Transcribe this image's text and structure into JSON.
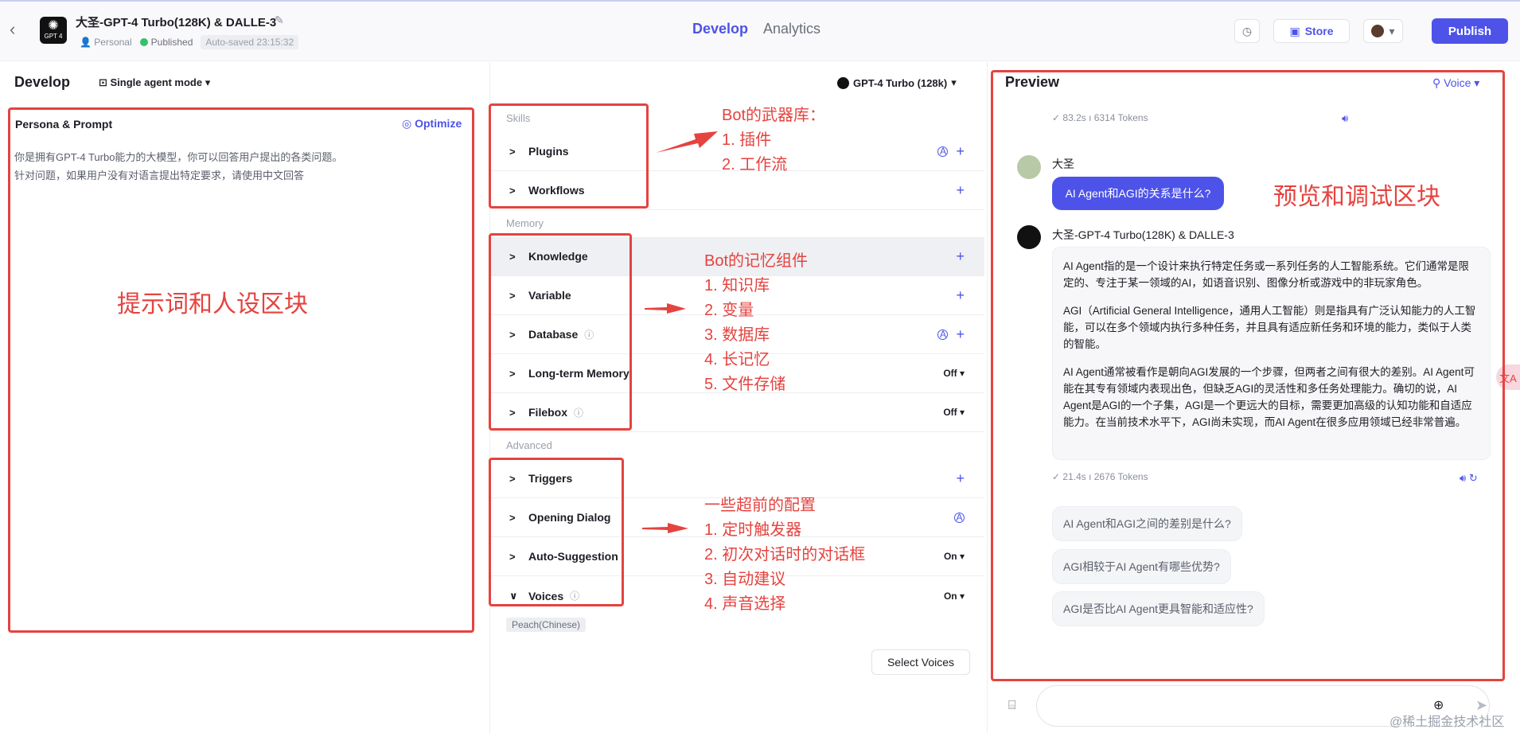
{
  "header": {
    "back_glyph": "‹",
    "bot_title": "大圣-GPT-4 Turbo(128K) & DALLE-3",
    "logo_text": "GPT 4",
    "workspace": "Personal",
    "status": "Published",
    "autosave": "Auto-saved 23:15:32",
    "tabs": [
      "Develop",
      "Analytics"
    ],
    "store_label": "Store",
    "publish_label": "Publish"
  },
  "develop": {
    "title": "Develop",
    "agent_mode": "Single agent mode",
    "model": "GPT-4 Turbo (128k)"
  },
  "persona": {
    "title": "Persona & Prompt",
    "optimize_label": "Optimize",
    "prompt_text": "你是拥有GPT-4 Turbo能力的大模型，你可以回答用户提出的各类问题。\n针对问题，如果用户没有对语言提出特定要求，请使用中文回答"
  },
  "config": {
    "sections": [
      "Skills",
      "Memory",
      "Advanced"
    ],
    "skills": [
      "Plugins",
      "Workflows"
    ],
    "memory": [
      "Knowledge",
      "Variable",
      "Database",
      "Long-term Memory",
      "Filebox"
    ],
    "advanced": [
      "Triggers",
      "Opening Dialog",
      "Auto-Suggestion",
      "Voices"
    ],
    "long_term_memory_state": "Off",
    "filebox_state": "Off",
    "auto_suggestion_state": "On",
    "voices_state": "On",
    "voice_tag": "Peach(Chinese)",
    "select_voices_label": "Select Voices"
  },
  "preview": {
    "title": "Preview",
    "voice_label": "Voice",
    "meta_top": "✓ 83.2s  ı  6314 Tokens",
    "user_name": "大圣",
    "user_message": "AI Agent和AGI的关系是什么?",
    "bot_name": "大圣-GPT-4 Turbo(128K) & DALLE-3",
    "bot_reply": [
      "AI Agent指的是一个设计来执行特定任务或一系列任务的人工智能系统。它们通常是限定的、专注于某一领域的AI，如语音识别、图像分析或游戏中的非玩家角色。",
      "AGI（Artificial General Intelligence，通用人工智能）则是指具有广泛认知能力的人工智能，可以在多个领域内执行多种任务，并且具有适应新任务和环境的能力，类似于人类的智能。",
      "AI Agent通常被看作是朝向AGI发展的一个步骤，但两者之间有很大的差别。AI Agent可能在其专有领域内表现出色，但缺乏AGI的灵活性和多任务处理能力。确切的说，AI Agent是AGI的一个子集，AGI是一个更远大的目标，需要更加高级的认知功能和自适应能力。在当前技术水平下，AGI尚未实现，而AI Agent在很多应用领域已经非常普遍。"
    ],
    "meta_reply": "✓ 21.4s  ı  2676 Tokens",
    "suggestions": [
      "AI Agent和AGI之间的差别是什么?",
      "AGI相较于AI Agent有哪些优势?",
      "AGI是否比AI Agent更具智能和适应性?"
    ],
    "side_float_glyph": "文A"
  },
  "annotations": {
    "persona_area": "提示词和人设区块",
    "skills": "Bot的武器库：\n1. 插件\n2. 工作流",
    "memory": "Bot的记忆组件\n1. 知识库\n2. 变量\n3. 数据库\n4. 长记忆\n5. 文件存储",
    "advanced": "一些超前的配置\n1. 定时触发器\n2. 初次对话时的对话框\n3. 自动建议\n4. 声音选择",
    "preview_area": "预览和调试区块"
  },
  "watermark": "@稀土掘金技术社区",
  "colors": {
    "accent": "#4d53e8",
    "annotation": "#e5433f",
    "published": "#33c26b"
  }
}
